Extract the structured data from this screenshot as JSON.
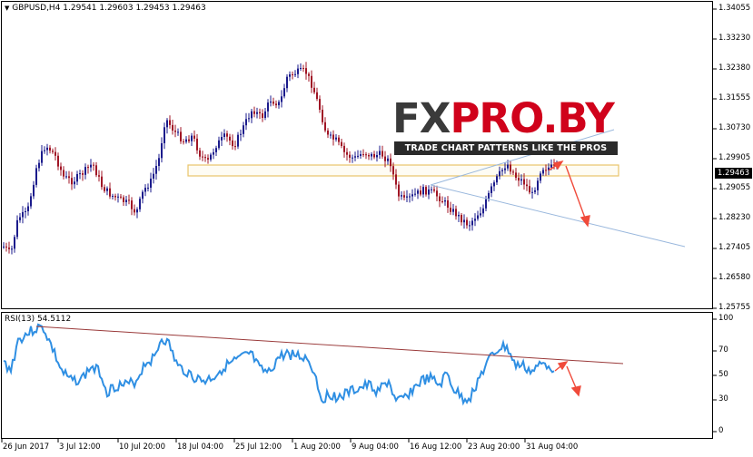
{
  "window": {
    "symbol_info": "GBPUSD,H4  1.29541 1.29603 1.29453 1.29463",
    "current_price": "1.29463"
  },
  "price_axis": {
    "labels": [
      "1.34055",
      "1.33230",
      "1.32380",
      "1.31555",
      "1.30730",
      "1.29905",
      "1.29055",
      "1.28230",
      "1.27405",
      "1.26580",
      "1.25755"
    ]
  },
  "indicator": {
    "label": "RSI(13) 54.5112",
    "levels": [
      "100",
      "70",
      "50",
      "30",
      "0"
    ]
  },
  "time_axis": {
    "labels": [
      "26 Jun 2017",
      "3 Jul 12:00",
      "10 Jul 20:00",
      "18 Jul 04:00",
      "25 Jul 12:00",
      "1 Aug 20:00",
      "9 Aug 04:00",
      "16 Aug 12:00",
      "23 Aug 20:00",
      "31 Aug 04:00"
    ]
  },
  "watermark": {
    "logo_left": "FX",
    "logo_right": "PRO.BY",
    "tagline": "TRADE CHART PATTERNS LIKE THE PROS"
  },
  "colors": {
    "bull": "#1b1b8c",
    "bear": "#a01525",
    "rsi_line": "#2f8fe3",
    "rsi_trendline": "#9a3a3a",
    "channel": "#9ab8dd",
    "zone": "#e8c46a",
    "forecast_arrow": "#f04a3a",
    "logo_red": "#d0021b",
    "logo_dark": "#3a3a3a"
  }
}
